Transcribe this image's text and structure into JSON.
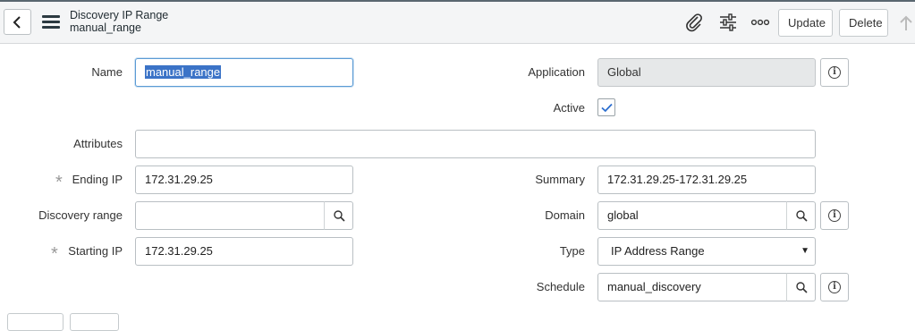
{
  "header": {
    "title": "Discovery IP Range",
    "subtitle": "manual_range",
    "update_label": "Update",
    "delete_label": "Delete"
  },
  "form": {
    "name": {
      "label": "Name",
      "value": "manual_range"
    },
    "application": {
      "label": "Application",
      "value": "Global"
    },
    "active": {
      "label": "Active",
      "checked": true
    },
    "attributes": {
      "label": "Attributes",
      "value": ""
    },
    "ending_ip": {
      "label": "Ending IP",
      "value": "172.31.29.25",
      "required": "*"
    },
    "summary": {
      "label": "Summary",
      "value": "172.31.29.25-172.31.29.25"
    },
    "discovery_range": {
      "label": "Discovery range",
      "value": ""
    },
    "domain": {
      "label": "Domain",
      "value": "global"
    },
    "starting_ip": {
      "label": "Starting IP",
      "value": "172.31.29.25",
      "required": "*"
    },
    "type": {
      "label": "Type",
      "value": "IP Address Range"
    },
    "schedule": {
      "label": "Schedule",
      "value": "manual_discovery"
    }
  },
  "icons": {
    "back": "chevron-left-icon",
    "menu": "hamburger-icon",
    "attachment": "paperclip-icon",
    "personalize": "sliders-icon",
    "more": "more-options-icon",
    "scroll_top": "arrow-up-icon",
    "search": "magnifier-icon",
    "info": "info-icon"
  },
  "colors": {
    "accent": "#3b73c7",
    "header_bg": "#f4f5f6",
    "readonly_bg": "#e6e8e9"
  }
}
